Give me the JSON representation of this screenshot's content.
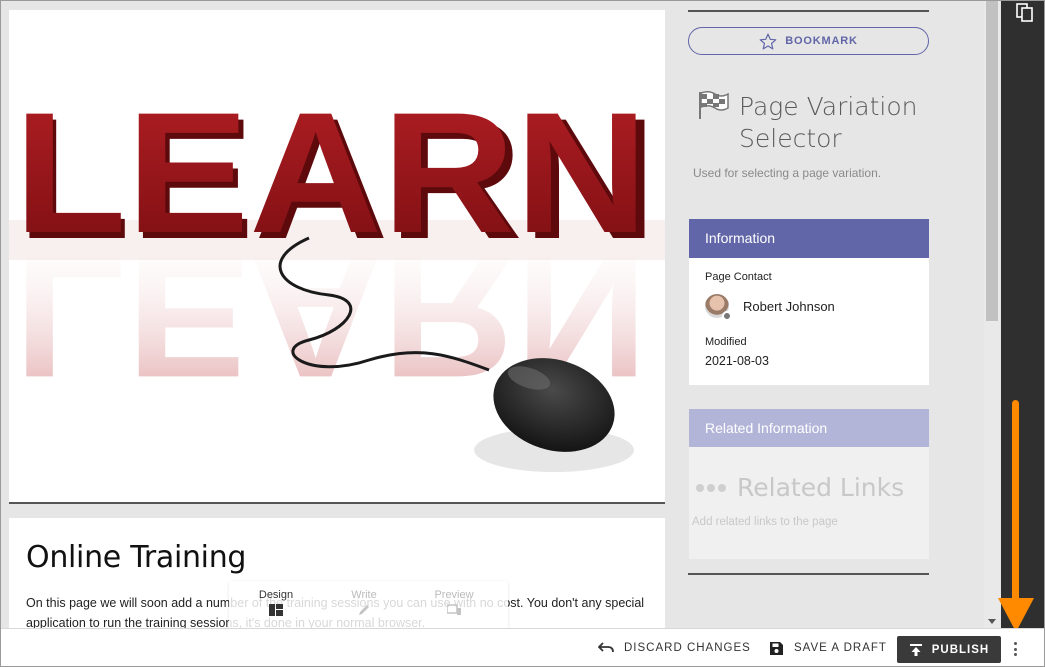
{
  "hero": {
    "image_word": "LEARN"
  },
  "article": {
    "title": "Online Training",
    "body": "On this page we will soon add a number of the training sessions you can use with no cost. You don't any special application to run the training sessions, it's done in your normal browser."
  },
  "viewbar": {
    "design_label": "Design",
    "write_label": "Write",
    "preview_label": "Preview"
  },
  "sidebar": {
    "bookmark_label": "BOOKMARK",
    "block_title": "Page Variation Selector",
    "block_description": "Used for selecting a page variation.",
    "information": {
      "heading": "Information",
      "contact_label": "Page Contact",
      "contact_name": "Robert Johnson",
      "modified_label": "Modified",
      "modified_value": "2021-08-03"
    },
    "related": {
      "heading": "Related Information",
      "links_title": "Related Links",
      "links_description": "Add related links to the page"
    }
  },
  "actions": {
    "discard_label": "DISCARD CHANGES",
    "save_draft_label": "SAVE A DRAFT",
    "publish_label": "PUBLISH"
  },
  "colors": {
    "accent": "#6166a8",
    "accent_light": "#b3b5d8",
    "annotation": "#ff8a00",
    "rail": "#2f2f2f"
  }
}
